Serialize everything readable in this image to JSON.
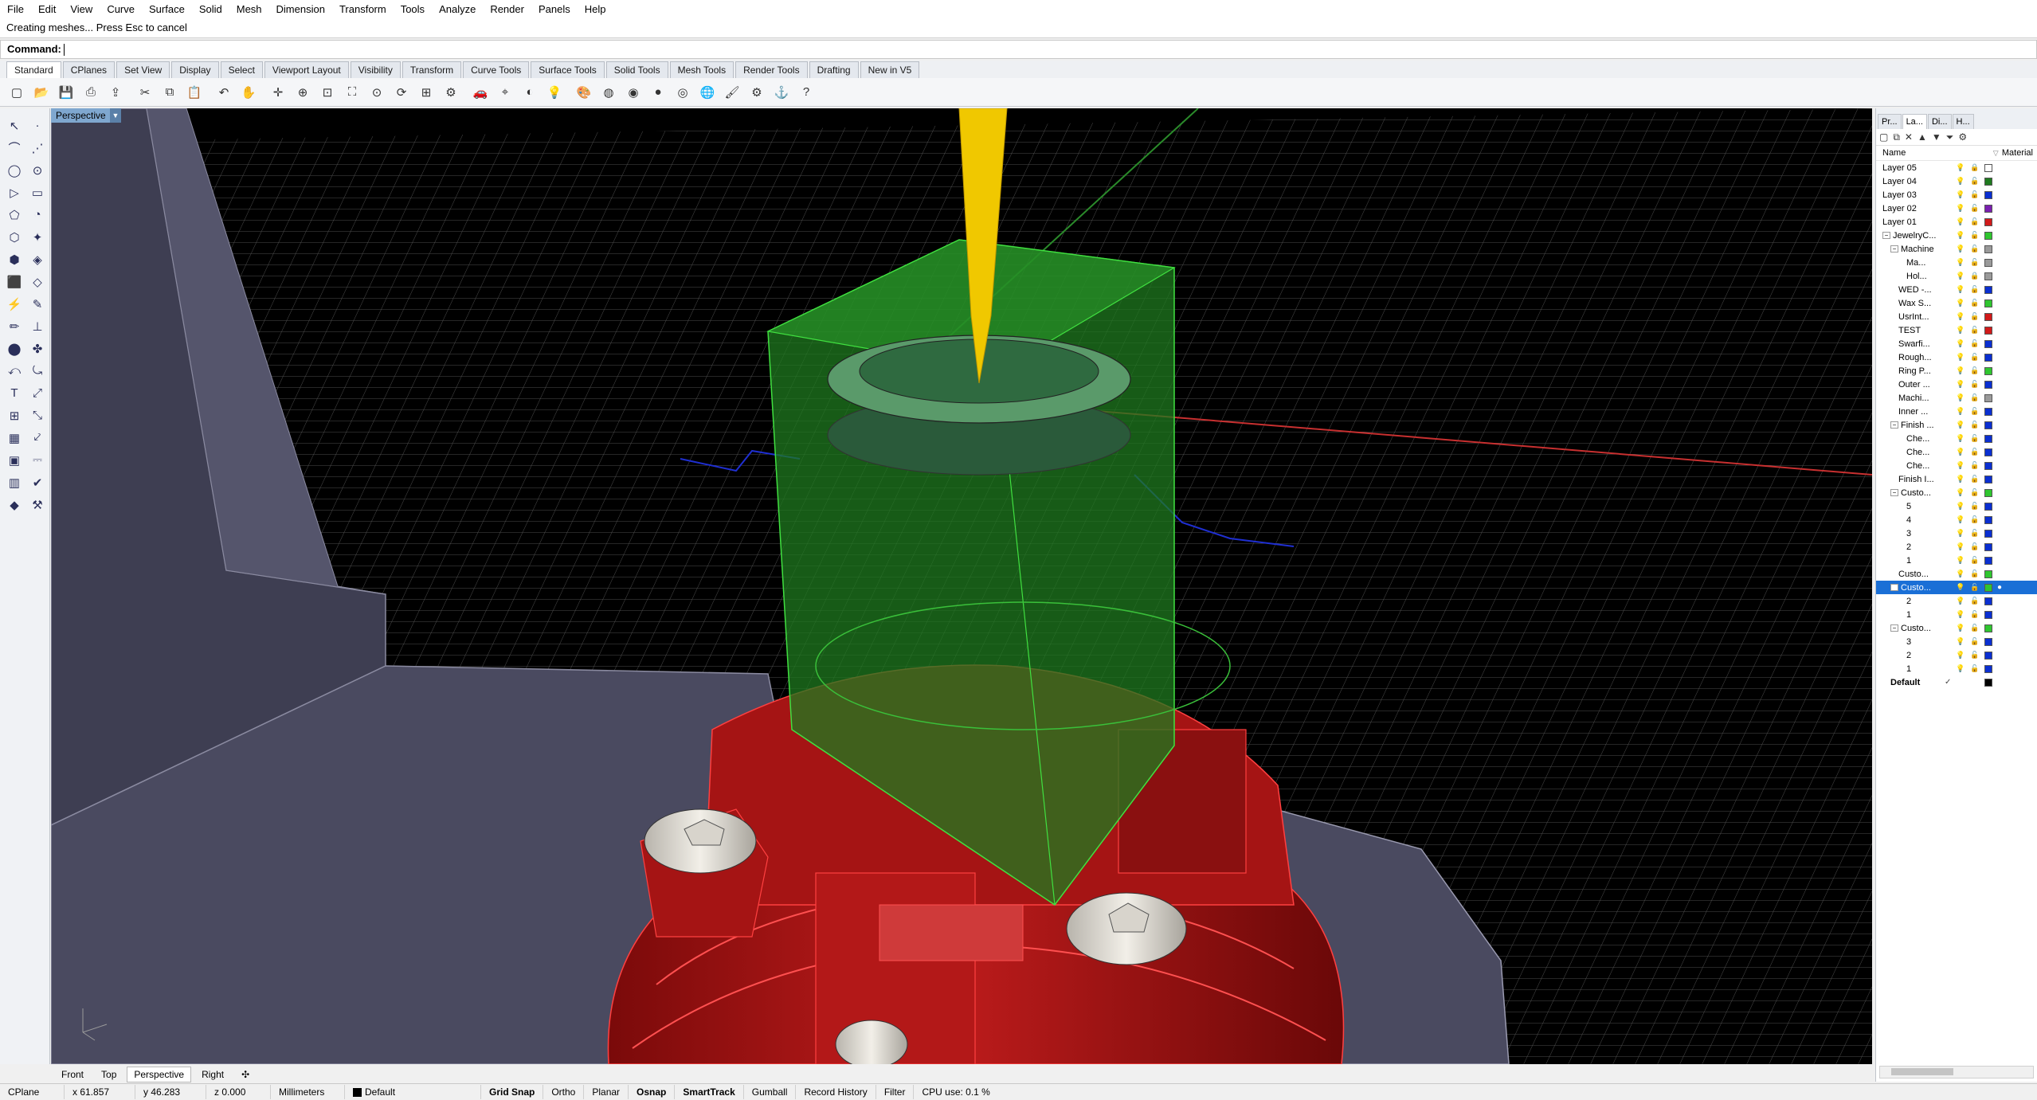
{
  "menu": [
    "File",
    "Edit",
    "View",
    "Curve",
    "Surface",
    "Solid",
    "Mesh",
    "Dimension",
    "Transform",
    "Tools",
    "Analyze",
    "Render",
    "Panels",
    "Help"
  ],
  "command": {
    "history": "Creating meshes... Press Esc to cancel",
    "prompt": "Command:"
  },
  "toolbar_tabs": [
    "Standard",
    "CPlanes",
    "Set View",
    "Display",
    "Select",
    "Viewport Layout",
    "Visibility",
    "Transform",
    "Curve Tools",
    "Surface Tools",
    "Solid Tools",
    "Mesh Tools",
    "Render Tools",
    "Drafting",
    "New in V5"
  ],
  "toolbar_icons": [
    "new-icon",
    "open-icon",
    "save-icon",
    "print-icon",
    "import-icon",
    "cut-icon",
    "copy-icon",
    "paste-icon",
    "undo-icon",
    "pan-icon",
    "move-icon",
    "zoom-icon",
    "zoom-window-icon",
    "zoom-extents-icon",
    "zoom-selected-icon",
    "rotate-view-icon",
    "four-view-icon",
    "options-icon",
    "car-icon",
    "cplane-icon",
    "hide-icon",
    "light-icon",
    "render-icon",
    "material-icon",
    "color-icon",
    "sphere-icon",
    "render-preview-icon",
    "environment-icon",
    "brush-icon",
    "settings-icon",
    "snap-icon",
    "help-icon"
  ],
  "toolbar_glyphs": [
    "▢",
    "📂",
    "💾",
    "⎙",
    "⇪",
    "✂",
    "⧉",
    "📋",
    "↶",
    "✋",
    "✛",
    "⊕",
    "⊡",
    "⛶",
    "⊙",
    "⟳",
    "⊞",
    "⚙",
    "🚗",
    "⌖",
    "◐",
    "💡",
    "🎨",
    "◍",
    "◉",
    "●",
    "◎",
    "🌐",
    "🖌",
    "⚙",
    "⚓",
    "?"
  ],
  "left_tools": [
    "↖",
    "·",
    "⌒",
    "⋰",
    "◯",
    "⊙",
    "▷",
    "▭",
    "⬠",
    "◔",
    "⬡",
    "✦",
    "⬢",
    "◈",
    "⬛",
    "◇",
    "⚡",
    "✎",
    "✏",
    "⊥",
    "⬤",
    "✤",
    "⤺",
    "⤿",
    "T",
    "⤢",
    "⊞",
    "⤡",
    "▦",
    "⤦",
    "▣",
    "⎓",
    "▥",
    "✔",
    "◆",
    "⚒"
  ],
  "viewport": {
    "name": "Perspective",
    "dropdown": "▼"
  },
  "viewport_tabs": [
    "Front",
    "Top",
    "Perspective",
    "Right"
  ],
  "viewport_tab_add": "✣",
  "status": {
    "cplane": "CPlane",
    "x": "x 61.857",
    "y": "y 46.283",
    "z": "z 0.000",
    "units": "Millimeters",
    "layer": "Default",
    "grid_snap": "Grid Snap",
    "ortho": "Ortho",
    "planar": "Planar",
    "osnap": "Osnap",
    "smarttrack": "SmartTrack",
    "gumball": "Gumball",
    "record_history": "Record History",
    "filter": "Filter",
    "cpu": "CPU use: 0.1 %"
  },
  "panel": {
    "tabs": [
      "Pr...",
      "La...",
      "Di...",
      "H..."
    ],
    "columns": {
      "name": "Name",
      "material": "Material"
    },
    "layers": [
      {
        "name": "Layer 05",
        "indent": 0,
        "expand": "",
        "color": "#ffffff",
        "lock": true
      },
      {
        "name": "Layer 04",
        "indent": 0,
        "expand": "",
        "color": "#1f7a1f",
        "lock": false
      },
      {
        "name": "Layer 03",
        "indent": 0,
        "expand": "",
        "color": "#0a2fd1",
        "lock": false
      },
      {
        "name": "Layer 02",
        "indent": 0,
        "expand": "",
        "color": "#7a1fb0",
        "lock": false
      },
      {
        "name": "Layer 01",
        "indent": 0,
        "expand": "",
        "color": "#d11a1a",
        "lock": false
      },
      {
        "name": "JewelryC...",
        "indent": 0,
        "expand": "−",
        "color": "#2fc62f",
        "lock": false
      },
      {
        "name": "Machine",
        "indent": 1,
        "expand": "−",
        "color": "#9a9a9a",
        "lock": false
      },
      {
        "name": "Ma...",
        "indent": 3,
        "expand": "",
        "color": "#9a9a9a",
        "lock": false
      },
      {
        "name": "Hol...",
        "indent": 3,
        "expand": "",
        "color": "#9a9a9a",
        "lock": true
      },
      {
        "name": "WED -...",
        "indent": 2,
        "expand": "",
        "color": "#0a2fd1",
        "lock": false
      },
      {
        "name": "Wax S...",
        "indent": 2,
        "expand": "",
        "color": "#2fc62f",
        "lock": false
      },
      {
        "name": "UsrInt...",
        "indent": 2,
        "expand": "",
        "color": "#d11a1a",
        "lock": false
      },
      {
        "name": "TEST",
        "indent": 2,
        "expand": "",
        "color": "#d11a1a",
        "lock": false
      },
      {
        "name": "Swarfi...",
        "indent": 2,
        "expand": "",
        "color": "#0a2fd1",
        "lock": false
      },
      {
        "name": "Rough...",
        "indent": 2,
        "expand": "",
        "color": "#0a2fd1",
        "lock": false
      },
      {
        "name": "Ring P...",
        "indent": 2,
        "expand": "",
        "color": "#2fc62f",
        "lock": false
      },
      {
        "name": "Outer ...",
        "indent": 2,
        "expand": "",
        "color": "#0a2fd1",
        "lock": false
      },
      {
        "name": "Machi...",
        "indent": 2,
        "expand": "",
        "color": "#9a9a9a",
        "lock": false
      },
      {
        "name": "Inner ...",
        "indent": 2,
        "expand": "",
        "color": "#0a2fd1",
        "lock": false
      },
      {
        "name": "Finish ...",
        "indent": 1,
        "expand": "−",
        "color": "#0a2fd1",
        "lock": false
      },
      {
        "name": "Che...",
        "indent": 3,
        "expand": "",
        "color": "#0a2fd1",
        "lock": false
      },
      {
        "name": "Che...",
        "indent": 3,
        "expand": "",
        "color": "#0a2fd1",
        "lock": false
      },
      {
        "name": "Che...",
        "indent": 3,
        "expand": "",
        "color": "#0a2fd1",
        "lock": false
      },
      {
        "name": "Finish I...",
        "indent": 2,
        "expand": "",
        "color": "#0a2fd1",
        "lock": false
      },
      {
        "name": "Custo...",
        "indent": 1,
        "expand": "−",
        "color": "#2fc62f",
        "lock": false
      },
      {
        "name": "5",
        "indent": 3,
        "expand": "",
        "color": "#0a2fd1",
        "lock": false
      },
      {
        "name": "4",
        "indent": 3,
        "expand": "",
        "color": "#0a2fd1",
        "lock": false
      },
      {
        "name": "3",
        "indent": 3,
        "expand": "",
        "color": "#0a2fd1",
        "lock": false
      },
      {
        "name": "2",
        "indent": 3,
        "expand": "",
        "color": "#0a2fd1",
        "lock": false
      },
      {
        "name": "1",
        "indent": 3,
        "expand": "",
        "color": "#0a2fd1",
        "lock": false
      },
      {
        "name": "Custo...",
        "indent": 2,
        "expand": "",
        "color": "#2fc62f",
        "lock": false
      },
      {
        "name": "Custo...",
        "indent": 1,
        "expand": "−",
        "color": "#2fc62f",
        "lock": false,
        "selected": true
      },
      {
        "name": "2",
        "indent": 3,
        "expand": "",
        "color": "#0a2fd1",
        "lock": false
      },
      {
        "name": "1",
        "indent": 3,
        "expand": "",
        "color": "#0a2fd1",
        "lock": false
      },
      {
        "name": "Custo...",
        "indent": 1,
        "expand": "−",
        "color": "#2fc62f",
        "lock": false
      },
      {
        "name": "3",
        "indent": 3,
        "expand": "",
        "color": "#0a2fd1",
        "lock": false
      },
      {
        "name": "2",
        "indent": 3,
        "expand": "",
        "color": "#0a2fd1",
        "lock": false
      },
      {
        "name": "1",
        "indent": 3,
        "expand": "",
        "color": "#0a2fd1",
        "lock": false
      },
      {
        "name": "Default",
        "indent": 1,
        "expand": "",
        "color": "#000000",
        "lock": false,
        "bold": true,
        "current": true
      }
    ]
  },
  "colors": {
    "viewport_bg": "#000000",
    "grid": "#3a3a3a",
    "red_part": "#b01515",
    "green_stock": "#2a8a2a",
    "yellow_tool": "#f0c800",
    "selection": "#1a6fd6",
    "panel_bg": "#ffffff"
  }
}
